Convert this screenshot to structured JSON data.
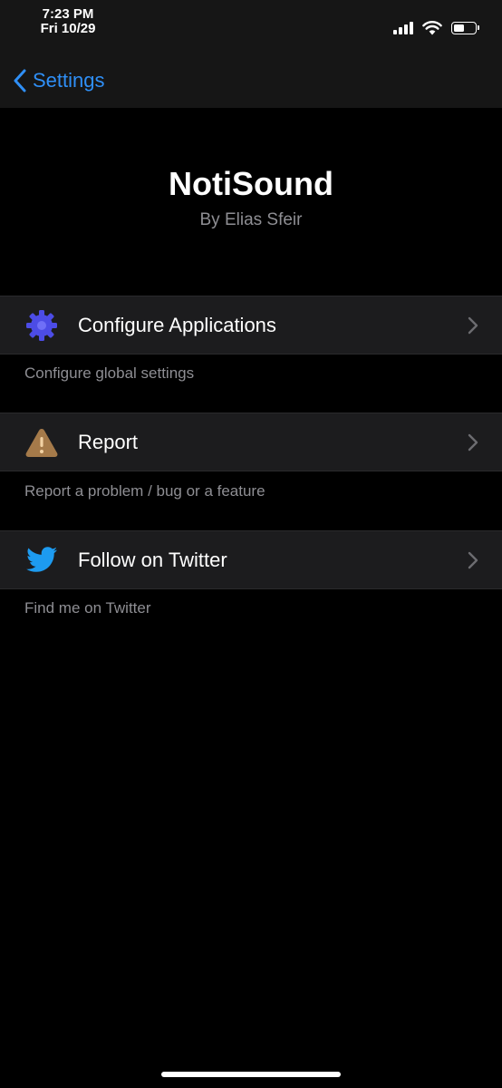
{
  "status_bar": {
    "time": "7:23 PM",
    "date": "Fri 10/29",
    "battery_level": 0.5
  },
  "nav": {
    "back_label": "Settings"
  },
  "header": {
    "title": "NotiSound",
    "subtitle": "By Elias Sfeir"
  },
  "items": [
    {
      "label": "Configure Applications",
      "footer": "Configure global settings",
      "icon": "gear-icon",
      "icon_color": "#4c4ce6"
    },
    {
      "label": "Report",
      "footer": "Report a problem / bug or a feature",
      "icon": "warning-icon",
      "icon_color": "#a57a4a"
    },
    {
      "label": "Follow on Twitter",
      "footer": "Find me on Twitter",
      "icon": "twitter-bird-icon",
      "icon_color": "#1d9bf0"
    }
  ],
  "colors": {
    "accent": "#2f8ff6",
    "background": "#000000",
    "cell_background": "#1c1c1e",
    "secondary_text": "#8e8e93"
  }
}
